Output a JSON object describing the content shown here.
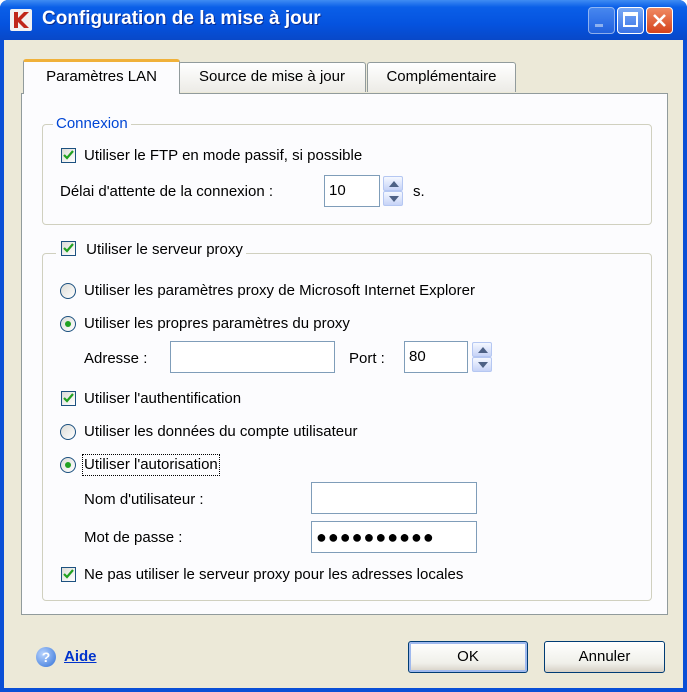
{
  "window": {
    "title": "Configuration de la mise à jour"
  },
  "tabs": [
    {
      "label": "Paramètres LAN",
      "active": true
    },
    {
      "label": "Source de mise à jour",
      "active": false
    },
    {
      "label": "Complémentaire",
      "active": false
    }
  ],
  "connexion": {
    "legend": "Connexion",
    "passive_ftp_label": "Utiliser le FTP en mode passif, si possible",
    "passive_ftp_checked": true,
    "timeout_label": "Délai d'attente de la connexion :",
    "timeout_value": "10",
    "timeout_unit": "s."
  },
  "proxy": {
    "use_proxy_label": "Utiliser le serveur proxy",
    "use_proxy_checked": true,
    "ie_settings_label": "Utiliser les paramètres proxy de Microsoft Internet Explorer",
    "own_settings_label": "Utiliser les propres paramètres du proxy",
    "selected_mode": "own",
    "address_label": "Adresse :",
    "address_value": "",
    "port_label": "Port :",
    "port_value": "80",
    "auth_label": "Utiliser l'authentification",
    "auth_checked": true,
    "account_data_label": "Utiliser les données du compte utilisateur",
    "authorization_label": "Utiliser l'autorisation",
    "auth_mode": "authorization",
    "username_label": "Nom d'utilisateur :",
    "username_value": "",
    "password_label": "Mot de passe :",
    "password_mask": "●●●●●●●●●●",
    "bypass_local_label": "Ne pas utiliser le serveur proxy pour les adresses locales",
    "bypass_local_checked": true
  },
  "footer": {
    "help_label": "Aide",
    "ok_label": "OK",
    "cancel_label": "Annuler"
  },
  "colors": {
    "titlebar": "#0553df",
    "dialog_bg": "#ece9d8",
    "link": "#0033cc",
    "accent_tab": "#f0b13a"
  }
}
